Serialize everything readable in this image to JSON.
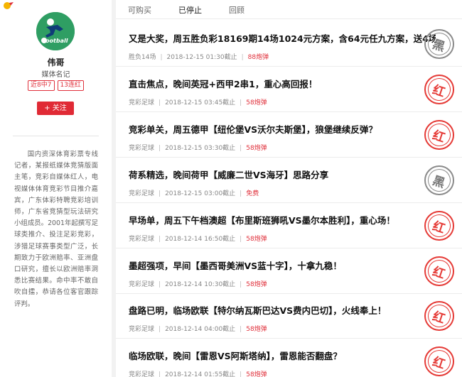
{
  "profile": {
    "avatar_text": "football",
    "name": "伟哥",
    "title": "媒体名记",
    "badges": [
      "近8中7",
      "13连红"
    ],
    "follow_label": "+ 关注",
    "bio": "国内资深体育彩票专线记者，某报纸媒体竞猜版面主笔，竞彩自媒体红人，电视媒体体育竞彩节目推介嘉宾，广东体彩特聘竞彩培训师，广东省竞猜型玩法研究小组成员。2001年起撰写足球类推介、投注足彩竞彩，涉猎足球赛事类型广泛，长期致力于欧洲赔率、亚洲盘口研究，擅长以欧洲赔率洞悉比赛结果。命中率不敢自吹自擂，恭请各位客官跟踪评判。"
  },
  "tabs": [
    "可购买",
    "已停止",
    "回顾"
  ],
  "articles": [
    {
      "title": "又是大奖，周五胜负彩18169期14场1024元方案，含64元任九方案，送4场稳胆！",
      "category": "胜负14场",
      "time": "2018-12-15 01:30截止",
      "price": "88炮弹",
      "stamp": "黑"
    },
    {
      "title": "直击焦点，晚间英冠+西甲2串1，重心高回报！",
      "category": "竞彩足球",
      "time": "2018-12-15 03:45截止",
      "price": "58炮弹",
      "stamp": "红"
    },
    {
      "title": "竞彩单关，周五德甲【纽伦堡VS沃尔夫斯堡】，狼堡继续反弹？",
      "category": "竞彩足球",
      "time": "2018-12-15 03:30截止",
      "price": "58炮弹",
      "stamp": "红"
    },
    {
      "title": "荷系精选，晚间荷甲【威廉二世VS海牙】思路分享",
      "category": "竞彩足球",
      "time": "2018-12-15 03:00截止",
      "price": "免费",
      "stamp": "黑"
    },
    {
      "title": "早场单，周五下午档澳超【布里斯班狮吼VS墨尔本胜利】，重心场！",
      "category": "竞彩足球",
      "time": "2018-12-14 16:50截止",
      "price": "58炮弹",
      "stamp": "红"
    },
    {
      "title": "墨超强项，早间【墨西哥美洲VS蓝十字】，十拿九稳！",
      "category": "竞彩足球",
      "time": "2018-12-14 10:30截止",
      "price": "58炮弹",
      "stamp": "红"
    },
    {
      "title": "盘路已明，临场欧联【特尔纳瓦斯巴达VS费内巴切】，火线奉上！",
      "category": "竞彩足球",
      "time": "2018-12-14 04:00截止",
      "price": "58炮弹",
      "stamp": "红"
    },
    {
      "title": "临场欧联，晚间【雷恩VS阿斯塔纳】，雷恩能否翻盘？",
      "category": "竞彩足球",
      "time": "2018-12-14 01:55截止",
      "price": "58炮弹",
      "stamp": "红"
    }
  ],
  "colors": {
    "accent_red": "#e0303b",
    "stamp_gray": "#8a8a8a",
    "avatar_green": "#2f9e63"
  },
  "icons": {
    "site_logo": "logo-mark-icon",
    "avatar": "football-player-icon"
  }
}
